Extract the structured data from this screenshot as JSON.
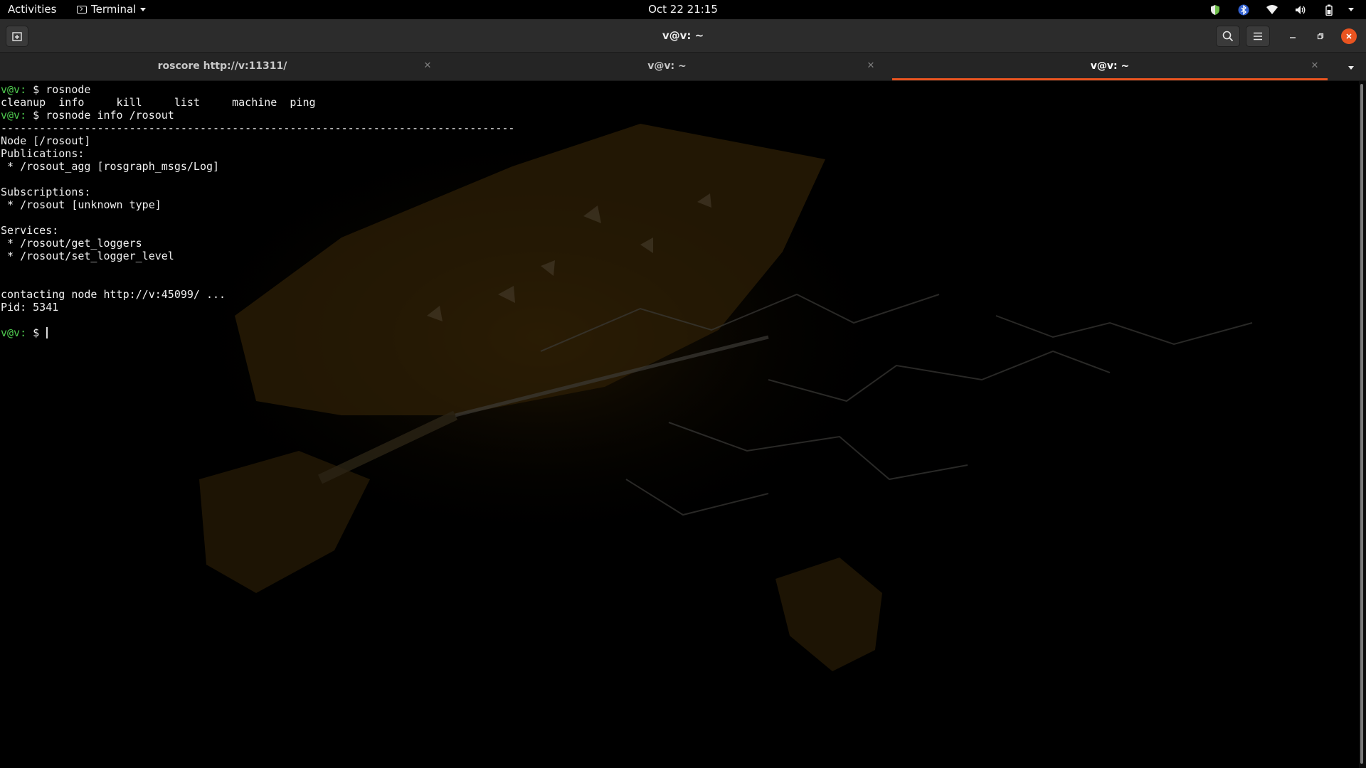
{
  "topbar": {
    "activities": "Activities",
    "app_name": "Terminal",
    "clock": "Oct 22  21:15",
    "tray": [
      "shield-icon",
      "bluetooth-icon",
      "wifi-icon",
      "volume-icon",
      "battery-icon",
      "system-menu-chevron-icon"
    ]
  },
  "window": {
    "title": "v@v: ~"
  },
  "tabs": [
    {
      "label": "roscore http://v:11311/",
      "active": false
    },
    {
      "label": "v@v: ~",
      "active": false
    },
    {
      "label": "v@v: ~",
      "active": true
    }
  ],
  "terminal": {
    "prompt": "v@v:",
    "lines": [
      {
        "prompt": "v@v:",
        "rest": " $ rosnode"
      },
      {
        "text": "cleanup  info     kill     list     machine  ping"
      },
      {
        "prompt": "v@v:",
        "rest": " $ rosnode info /rosout"
      },
      {
        "text": "--------------------------------------------------------------------------------"
      },
      {
        "text": "Node [/rosout]"
      },
      {
        "text": "Publications:"
      },
      {
        "text": " * /rosout_agg [rosgraph_msgs/Log]"
      },
      {
        "text": ""
      },
      {
        "text": "Subscriptions:"
      },
      {
        "text": " * /rosout [unknown type]"
      },
      {
        "text": ""
      },
      {
        "text": "Services:"
      },
      {
        "text": " * /rosout/get_loggers"
      },
      {
        "text": " * /rosout/set_logger_level"
      },
      {
        "text": ""
      },
      {
        "text": ""
      },
      {
        "text": "contacting node http://v:45099/ ..."
      },
      {
        "text": "Pid: 5341"
      },
      {
        "text": ""
      },
      {
        "prompt": "v@v:",
        "rest": " $ ",
        "cursor": true
      }
    ]
  },
  "colors": {
    "accent": "#e95420",
    "prompt": "#4ec94e"
  }
}
